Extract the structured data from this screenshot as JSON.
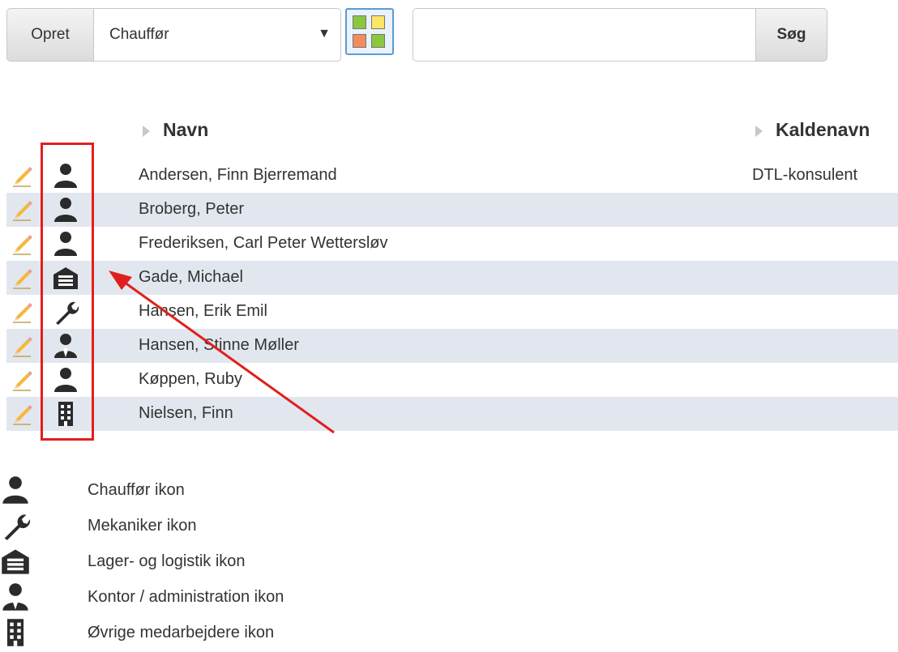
{
  "toolbar": {
    "create_label": "Opret",
    "type_select_value": "Chauffør",
    "search_value": "",
    "search_label": "Søg"
  },
  "table": {
    "columns": [
      "Navn",
      "Kaldenavn"
    ],
    "rows": [
      {
        "name": "Andersen, Finn Bjerremand",
        "nickname": "DTL-konsulent",
        "icon": "driver-icon"
      },
      {
        "name": "Broberg, Peter",
        "nickname": "",
        "icon": "driver-icon"
      },
      {
        "name": "Frederiksen, Carl Peter Wettersløv",
        "nickname": "",
        "icon": "driver-icon"
      },
      {
        "name": "Gade, Michael",
        "nickname": "",
        "icon": "warehouse-icon"
      },
      {
        "name": "Hansen, Erik Emil",
        "nickname": "",
        "icon": "wrench-icon"
      },
      {
        "name": "Hansen, Stinne Møller",
        "nickname": "",
        "icon": "office-worker-icon"
      },
      {
        "name": "Køppen, Ruby",
        "nickname": "",
        "icon": "driver-icon"
      },
      {
        "name": "Nielsen, Finn",
        "nickname": "",
        "icon": "building-icon"
      }
    ]
  },
  "legend": [
    {
      "label": "Chauffør ikon",
      "icon": "driver-icon"
    },
    {
      "label": "Mekaniker ikon",
      "icon": "wrench-icon"
    },
    {
      "label": "Lager- og logistik ikon",
      "icon": "warehouse-icon"
    },
    {
      "label": "Kontor / administration ikon",
      "icon": "office-worker-icon"
    },
    {
      "label": "Øvrige medarbejdere ikon",
      "icon": "building-icon"
    }
  ],
  "colors": {
    "highlight": "#e0201e",
    "row_alt": "#e2e7ef",
    "icon": "#2b2b2b"
  }
}
